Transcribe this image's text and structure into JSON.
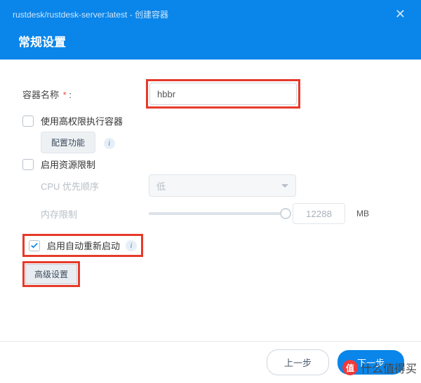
{
  "header": {
    "path": "rustdesk/rustdesk-server:latest - 创建容器",
    "title": "常规设置"
  },
  "form": {
    "name_label": "容器名称",
    "name_value": "hbbr",
    "privilege_label": "使用高权限执行容器",
    "config_btn": "配置功能",
    "resource_limit_label": "启用资源限制",
    "cpu_label": "CPU 优先顺序",
    "cpu_value": "低",
    "mem_label": "内存限制",
    "mem_value": "12288",
    "mem_unit": "MB",
    "auto_restart_label": "启用自动重新启动",
    "advanced_btn": "高级设置"
  },
  "footer": {
    "prev": "上一步",
    "next": "下一步"
  },
  "watermark": "什么值得买"
}
